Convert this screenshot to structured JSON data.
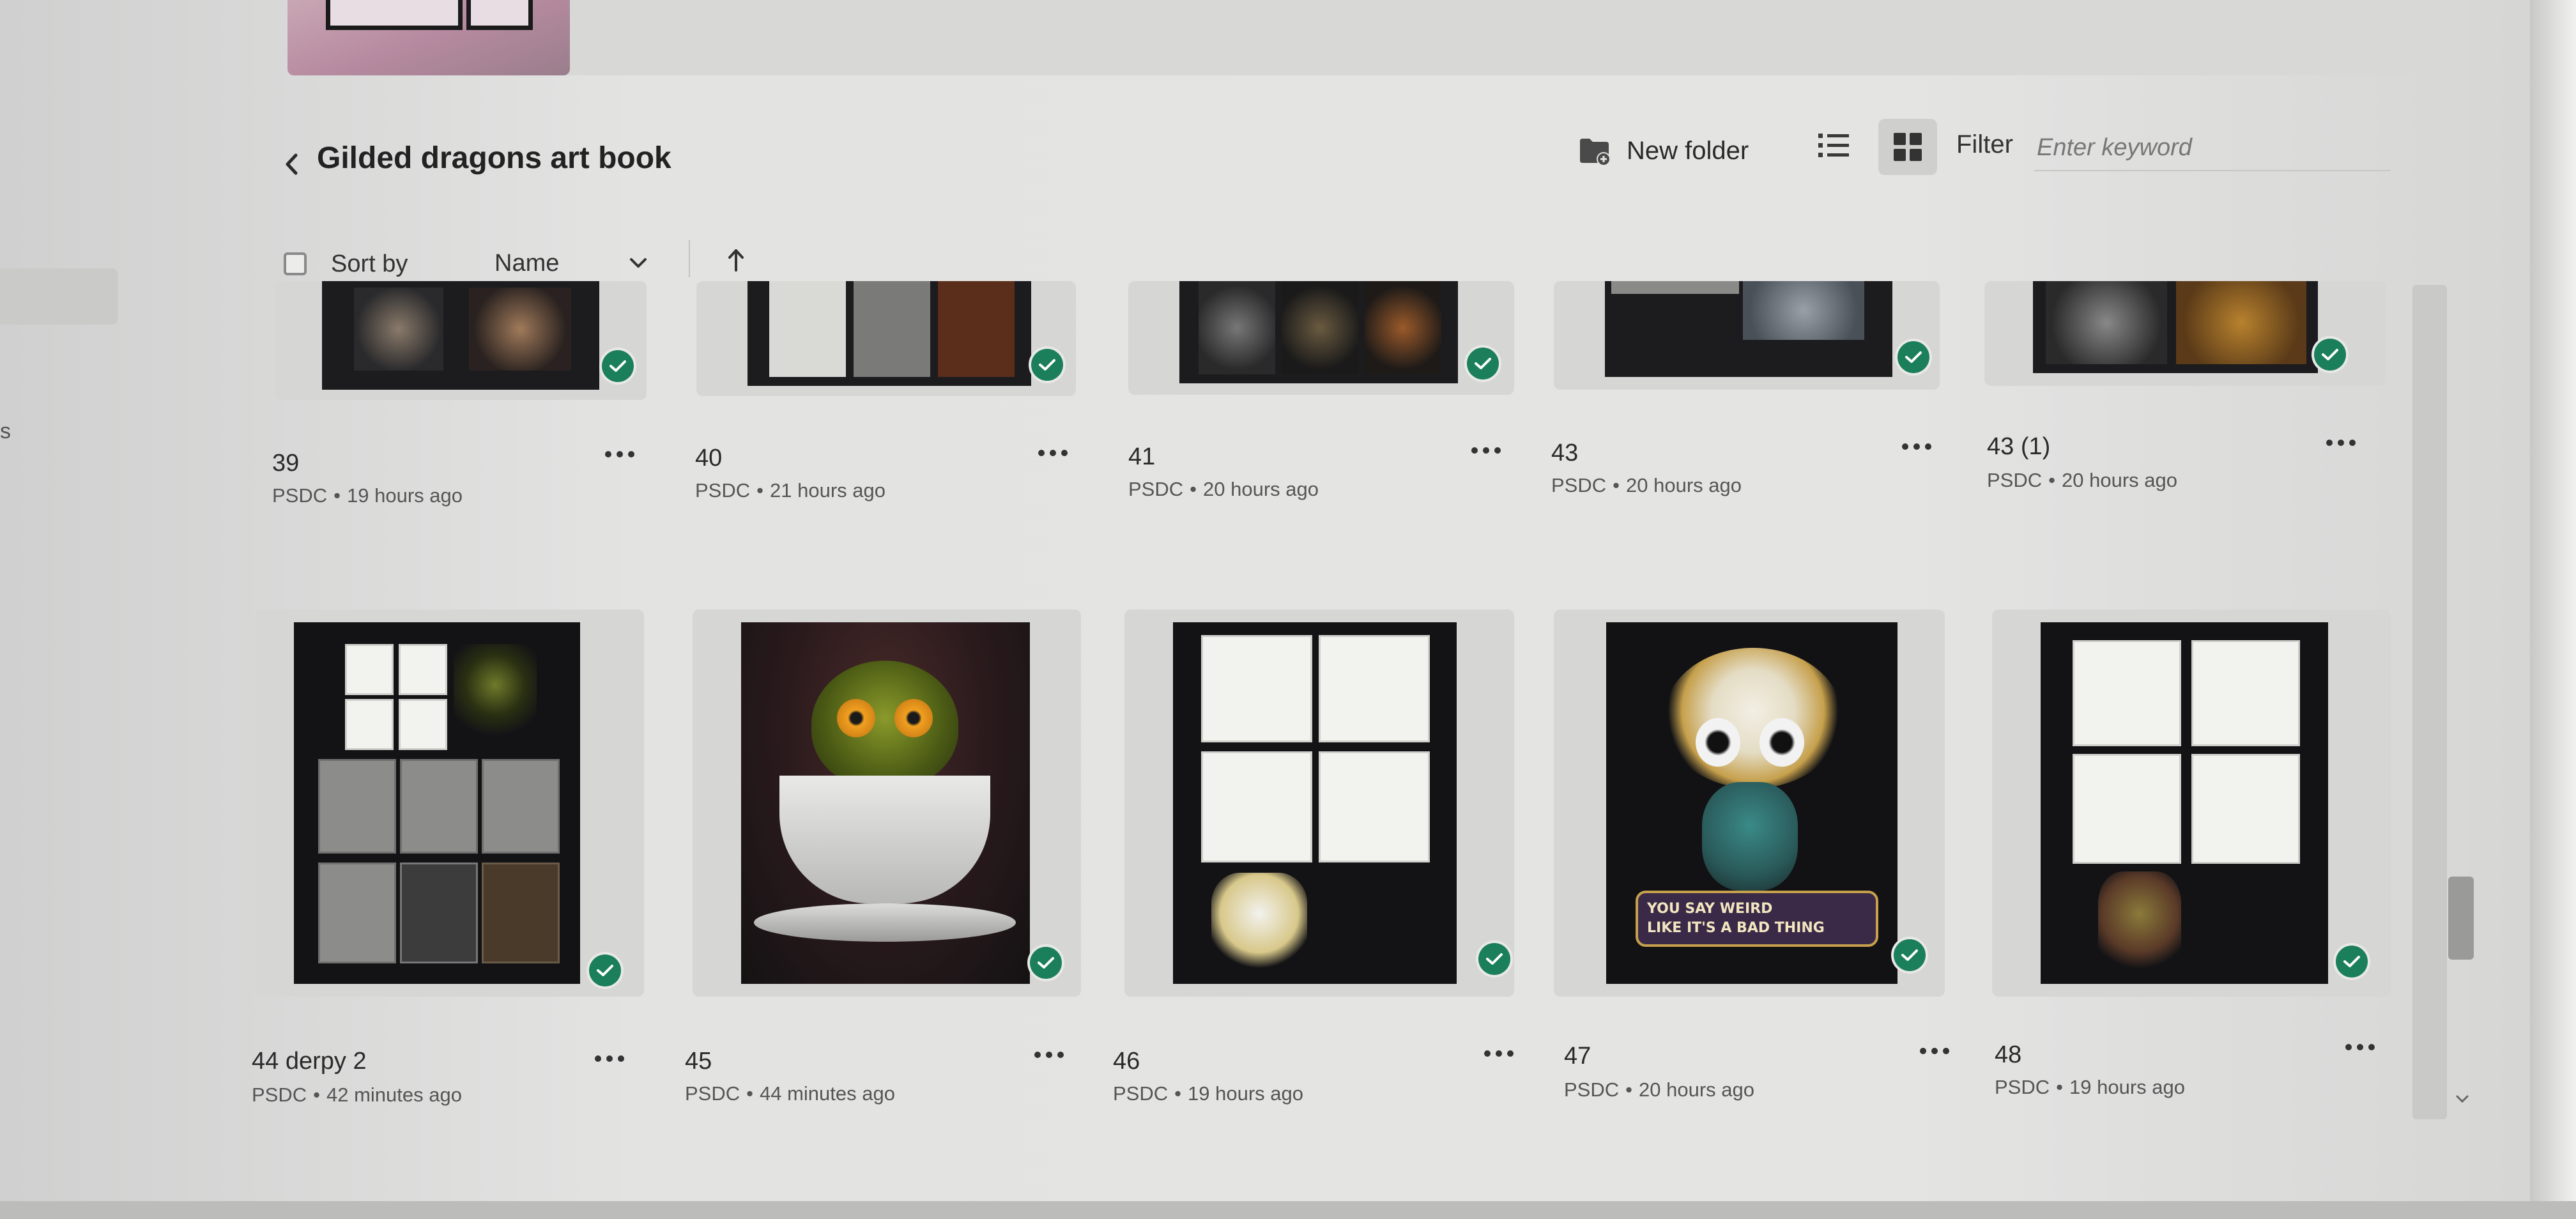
{
  "header": {
    "title": "Gilded dragons art book",
    "back_icon": "chevron-left-icon",
    "new_folder_label": "New folder",
    "filter_label": "Filter",
    "filter_placeholder": "Enter keyword"
  },
  "sort": {
    "label": "Sort by",
    "selected": "Name",
    "direction": "ascending"
  },
  "files": [
    {
      "name": "39",
      "owner": "PSDC",
      "sep": "•",
      "time": "19 hours ago",
      "synced": true
    },
    {
      "name": "40",
      "owner": "PSDC",
      "sep": "•",
      "time": "21 hours ago",
      "synced": true
    },
    {
      "name": "41",
      "owner": "PSDC",
      "sep": "•",
      "time": "20 hours ago",
      "synced": true
    },
    {
      "name": "43",
      "owner": "PSDC",
      "sep": "•",
      "time": "20 hours ago",
      "synced": true
    },
    {
      "name": "43 (1)",
      "owner": "PSDC",
      "sep": "•",
      "time": "20 hours ago",
      "synced": true
    },
    {
      "name": "44 derpy 2",
      "owner": "PSDC",
      "sep": "•",
      "time": "42 minutes ago",
      "synced": true
    },
    {
      "name": "45",
      "owner": "PSDC",
      "sep": "•",
      "time": "44 minutes ago",
      "synced": true
    },
    {
      "name": "46",
      "owner": "PSDC",
      "sep": "•",
      "time": "19 hours ago",
      "synced": true
    },
    {
      "name": "47",
      "owner": "PSDC",
      "sep": "•",
      "time": "20 hours ago",
      "synced": true
    },
    {
      "name": "48",
      "owner": "PSDC",
      "sep": "•",
      "time": "19 hours ago",
      "synced": true
    }
  ],
  "artwork_text": {
    "file_47_line1": "YOU SAY WEIRD",
    "file_47_line2": "LIKE IT'S A BAD THING"
  },
  "colors": {
    "sync_badge": "#1b7f5c",
    "background": "#e4e4e3"
  }
}
